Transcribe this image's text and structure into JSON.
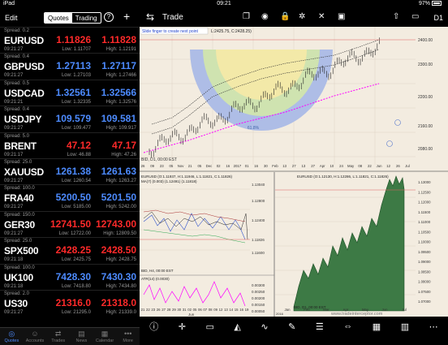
{
  "status": {
    "device": "iPad",
    "time": "09:21",
    "battery": "97%"
  },
  "left_header": {
    "edit": "Edit",
    "tab_quotes": "Quotes",
    "tab_trading": "Trading",
    "help": "?",
    "add": "+"
  },
  "quotes": [
    {
      "spread": "Spread: 0.2",
      "symbol": "EURUSD",
      "time": "09:21:27",
      "bid": "1.11826",
      "ask": "1.11828",
      "low": "Low: 1.11707",
      "high": "High: 1.12191",
      "color": "red"
    },
    {
      "spread": "Spread: 0.4",
      "symbol": "GBPUSD",
      "time": "09:21:27",
      "bid": "1.27113",
      "ask": "1.27117",
      "low": "Low: 1.27103",
      "high": "High: 1.27466",
      "color": "blue"
    },
    {
      "spread": "Spread: 0.5",
      "symbol": "USDCAD",
      "time": "09:21:21",
      "bid": "1.32561",
      "ask": "1.32566",
      "low": "Low: 1.32335",
      "high": "High: 1.32576",
      "color": "blue"
    },
    {
      "spread": "Spread: 0.4",
      "symbol": "USDJPY",
      "time": "09:21:27",
      "bid": "109.579",
      "ask": "109.581",
      "low": "Low: 109.477",
      "high": "High: 109.917",
      "color": "blue"
    },
    {
      "spread": "Spread: 5.0",
      "symbol": "BRENT",
      "time": "09:21:17",
      "bid": "47.12",
      "ask": "47.17",
      "low": "Low: 46.88",
      "high": "High: 47.26",
      "color": "red"
    },
    {
      "spread": "Spread: 25.0",
      "symbol": "XAUUSD",
      "time": "09:21:27",
      "bid": "1261.38",
      "ask": "1261.63",
      "low": "Low: 1260.54",
      "high": "High: 1263.27",
      "color": "blue"
    },
    {
      "spread": "Spread: 100.0",
      "symbol": "FRA40",
      "time": "09:21:27",
      "bid": "5200.50",
      "ask": "5201.50",
      "low": "Low: 5185.00",
      "high": "High: 5242.00",
      "color": "blue"
    },
    {
      "spread": "Spread: 150.0",
      "symbol": "GER30",
      "time": "09:21:27",
      "bid": "12741.50",
      "ask": "12743.00",
      "low": "Low: 12722.00",
      "high": "High: 12809.50",
      "color": "red"
    },
    {
      "spread": "Spread: 25.0",
      "symbol": "SPX500",
      "time": "09:21:18",
      "bid": "2428.25",
      "ask": "2428.50",
      "low": "Low: 2425.75",
      "high": "High: 2428.75",
      "color": "red"
    },
    {
      "spread": "Spread: 100.0",
      "symbol": "UK100",
      "time": "09:21:18",
      "bid": "7428.30",
      "ask": "7430.30",
      "low": "Low: 7418.80",
      "high": "High: 7434.80",
      "color": "blue"
    },
    {
      "spread": "Spread: 2.0",
      "symbol": "US30",
      "time": "09:21:27",
      "bid": "21316.0",
      "ask": "21318.0",
      "low": "Low: 21295.0",
      "high": "High: 21339.0",
      "color": "red"
    }
  ],
  "bottom_tabs": [
    {
      "label": "Quotes",
      "icon": "quotes-icon",
      "glyph": "◎",
      "active": true
    },
    {
      "label": "Accounts",
      "icon": "accounts-icon",
      "glyph": "☺",
      "active": false
    },
    {
      "label": "Trades",
      "icon": "trades-icon",
      "glyph": "⇄",
      "active": false
    },
    {
      "label": "News",
      "icon": "news-icon",
      "glyph": "▤",
      "active": false
    },
    {
      "label": "Calendar",
      "icon": "calendar-icon",
      "glyph": "▦",
      "active": false
    },
    {
      "label": "More",
      "icon": "more-icon",
      "glyph": "•••",
      "active": false
    }
  ],
  "right_header": {
    "title": "Trade",
    "timeframe": "D1"
  },
  "main_chart": {
    "hint": "Slide finger to create next point",
    "info": "L:2425.75, C:2428.25)",
    "fib_label": "61.8%",
    "footer": "BID, D1, 00:00 EST",
    "yticks": [
      "2400.00",
      "2300.00",
      "2200.00",
      "2160.00",
      "2080.00"
    ],
    "xticks": [
      "26",
      "09",
      "23",
      "05",
      "Nov",
      "21",
      "05",
      "Dec",
      "02",
      "16",
      "2017",
      "01",
      "16",
      "30",
      "Feb",
      "13",
      "27",
      "13",
      "27",
      "Apr",
      "10",
      "24",
      "May",
      "08",
      "22",
      "Jun",
      "12",
      "26",
      "Jul"
    ]
  },
  "sub_chart_left": {
    "info": "EURUSD (O:1.11937, H:1.11946, L:1.11821, C:1.11826)",
    "ma": "MA(7) (0.003) (1.12491) (1.11818)",
    "footer": "BID, H4, 00:00 EST",
    "yticks": [
      "1.13040",
      "1.12800",
      "1.12400",
      "1.11826",
      "1.11600"
    ],
    "xticks": [
      "21",
      "22",
      "23",
      "26",
      "27",
      "28",
      "29",
      "30",
      "31",
      "02",
      "05",
      "06",
      "07",
      "08",
      "09",
      "12",
      "13",
      "14",
      "15",
      "16",
      "19"
    ],
    "month": "Jun",
    "atr_label": "ATR(14) (0.0030)",
    "atr_yticks": [
      "0.00300",
      "0.00250",
      "0.00200",
      "0.00150",
      "0.00050"
    ]
  },
  "sub_chart_right": {
    "info": "EURUSD (O:1.12130, H:1.12286, L:1.11821, C:1.11826)",
    "footer": "BID, D1, 00:00 EST",
    "yticks": [
      "1.13000",
      "1.12500",
      "1.12000",
      "1.11500",
      "1.11000",
      "1.10500",
      "1.10000",
      "1.09500",
      "1.09000",
      "1.08500",
      "1.08000",
      "1.07500",
      "1.07000"
    ],
    "xticks": [
      "Jan",
      "Feb",
      "Mar",
      "Apr",
      "May",
      "Jun",
      "Jul"
    ],
    "year": "2016",
    "watermark": "www.tradeinterceptor.com"
  },
  "toolbar_icons": [
    {
      "name": "account-info-icon",
      "glyph": "ⓘ"
    },
    {
      "name": "crosshair-icon",
      "glyph": "✛"
    },
    {
      "name": "compare-icon",
      "glyph": "▭"
    },
    {
      "name": "chart-type-icon",
      "glyph": "◭"
    },
    {
      "name": "indicator-icon",
      "glyph": "∿"
    },
    {
      "name": "draw-icon",
      "glyph": "✎"
    },
    {
      "name": "levels-icon",
      "glyph": "☰"
    },
    {
      "name": "zoom-icon",
      "glyph": "⇔"
    },
    {
      "name": "grid-icon",
      "glyph": "▦"
    },
    {
      "name": "bars-icon",
      "glyph": "▥"
    },
    {
      "name": "more-tools-icon",
      "glyph": "⋯"
    }
  ]
}
